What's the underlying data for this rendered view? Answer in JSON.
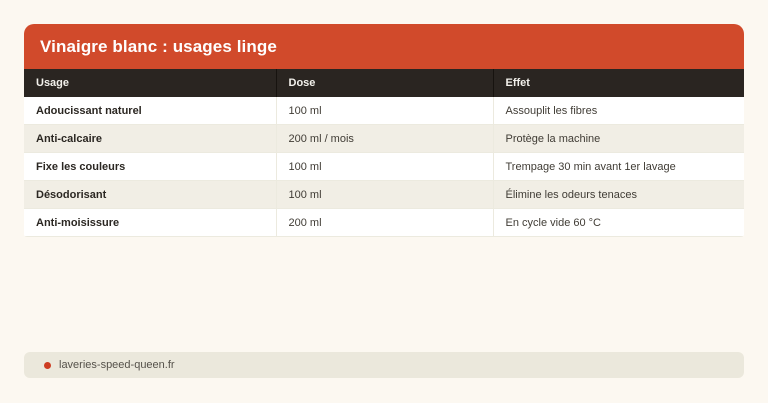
{
  "card": {
    "title": "Vinaigre blanc : usages linge"
  },
  "table": {
    "columns": [
      "Usage",
      "Dose",
      "Effet"
    ],
    "rows": [
      [
        "Adoucissant naturel",
        "100 ml",
        "Assouplit les fibres"
      ],
      [
        "Anti-calcaire",
        "200 ml / mois",
        "Protège la machine"
      ],
      [
        "Fixe les couleurs",
        "100 ml",
        "Trempage 30 min avant 1er lavage"
      ],
      [
        "Désodorisant",
        "100 ml",
        "Élimine les odeurs tenaces"
      ],
      [
        "Anti-moisissure",
        "200 ml",
        "En cycle vide 60 °C"
      ]
    ]
  },
  "footer": {
    "source": "laveries-speed-queen.fr"
  },
  "colors": {
    "accent_orange": "#d14a2b",
    "header_dark": "#2a2521",
    "page_background": "#fcf8f1",
    "row_stripe": "#f1eee5",
    "footer_bar": "#ebe8dc",
    "footer_dot": "#cd3d22"
  },
  "chart_data": {
    "type": "table",
    "title": "Vinaigre blanc : usages linge",
    "columns": [
      "Usage",
      "Dose",
      "Effet"
    ],
    "rows": [
      {
        "usage": "Adoucissant naturel",
        "dose": "100 ml",
        "effet": "Assouplit les fibres"
      },
      {
        "usage": "Anti-calcaire",
        "dose": "200 ml / mois",
        "effet": "Protège la machine"
      },
      {
        "usage": "Fixe les couleurs",
        "dose": "100 ml",
        "effet": "Trempage 30 min avant 1er lavage"
      },
      {
        "usage": "Désodorisant",
        "dose": "100 ml",
        "effet": "Élimine les odeurs tenaces"
      },
      {
        "usage": "Anti-moisissure",
        "dose": "200 ml",
        "effet": "En cycle vide 60 °C"
      }
    ],
    "source": "laveries-speed-queen.fr",
    "layout": {
      "zebra_stripes": true,
      "header_style": "dark",
      "title_bar_style": "orange"
    }
  }
}
